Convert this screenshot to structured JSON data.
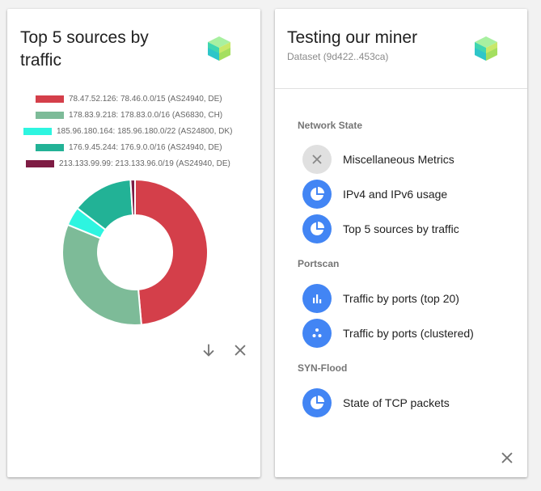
{
  "left_card": {
    "title": "Top 5 sources by traffic",
    "legend": [
      {
        "label": "78.47.52.126: 78.46.0.0/15 (AS24940, DE)",
        "color": "#d43f4a"
      },
      {
        "label": "178.83.9.218: 178.83.0.0/16 (AS6830, CH)",
        "color": "#7dbb98"
      },
      {
        "label": "185.96.180.164: 185.96.180.0/22 (AS24800, DK)",
        "color": "#2ef5e0"
      },
      {
        "label": "176.9.45.244: 176.9.0.0/16 (AS24940, DE)",
        "color": "#22b296"
      },
      {
        "label": "213.133.99.99: 213.133.96.0/19 (AS24940, DE)",
        "color": "#7e1c44"
      }
    ],
    "download_icon": "arrow-down-icon",
    "close_icon": "close-icon"
  },
  "chart_data": {
    "type": "pie",
    "donut": true,
    "categories": [
      "78.47.52.126: 78.46.0.0/15 (AS24940, DE)",
      "178.83.9.218: 178.83.0.0/16 (AS6830, CH)",
      "185.96.180.164: 185.96.180.0/22 (AS24800, DK)",
      "176.9.45.244: 176.9.0.0/16 (AS24940, DE)",
      "213.133.99.99: 213.133.96.0/19 (AS24940, DE)"
    ],
    "values": [
      48.6,
      32.6,
      4.2,
      13.6,
      1.0
    ],
    "colors": [
      "#d43f4a",
      "#7dbb98",
      "#2ef5e0",
      "#22b296",
      "#7e1c44"
    ],
    "title": "Top 5 sources by traffic",
    "legend_position": "top"
  },
  "right_card": {
    "title": "Testing our miner",
    "subtitle": "Dataset (9d422..453ca)",
    "sections": [
      {
        "header": "Network State",
        "items": [
          {
            "label": "Miscellaneous Metrics",
            "icon": "close-icon",
            "style": "grey"
          },
          {
            "label": "IPv4 and IPv6 usage",
            "icon": "pie-chart-icon",
            "style": "blue"
          },
          {
            "label": "Top 5 sources by traffic",
            "icon": "pie-chart-icon",
            "style": "blue"
          }
        ]
      },
      {
        "header": "Portscan",
        "items": [
          {
            "label": "Traffic by ports (top 20)",
            "icon": "bar-chart-icon",
            "style": "blue"
          },
          {
            "label": "Traffic by ports (clustered)",
            "icon": "scatter-plot-icon",
            "style": "blue"
          }
        ]
      },
      {
        "header": "SYN-Flood",
        "items": [
          {
            "label": "State of TCP packets",
            "icon": "pie-chart-icon",
            "style": "blue"
          }
        ]
      }
    ],
    "close_icon": "close-icon"
  }
}
